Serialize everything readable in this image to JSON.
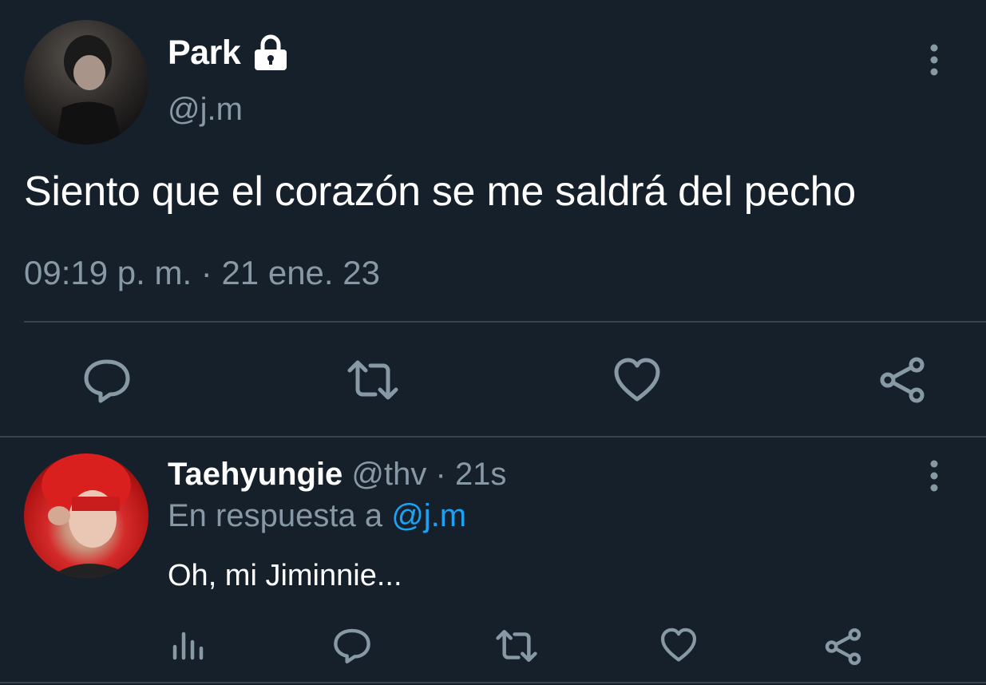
{
  "tweet": {
    "author_name": "Park",
    "author_handle": "@j.m",
    "text": "Siento que el corazón se me saldrá del pecho",
    "timestamp": "09:19 p. m. · 21 ene. 23",
    "icons": [
      "lock-icon",
      "more-vertical-icon",
      "reply-icon",
      "retweet-icon",
      "like-icon",
      "share-icon"
    ]
  },
  "reply": {
    "author_name": "Taehyungie",
    "author_handle": "@thv",
    "separator": " · ",
    "time_ago": "21s",
    "replying_prefix": "En respuesta a ",
    "replying_to": "@j.m",
    "text": "Oh, mi Jiminnie...",
    "icons": [
      "more-vertical-icon",
      "analytics-icon",
      "reply-icon",
      "retweet-icon",
      "like-icon",
      "share-icon"
    ]
  },
  "colors": {
    "background": "#15202b",
    "secondary_text": "#8899a6",
    "link": "#1da1f2",
    "divider": "#38444d"
  }
}
